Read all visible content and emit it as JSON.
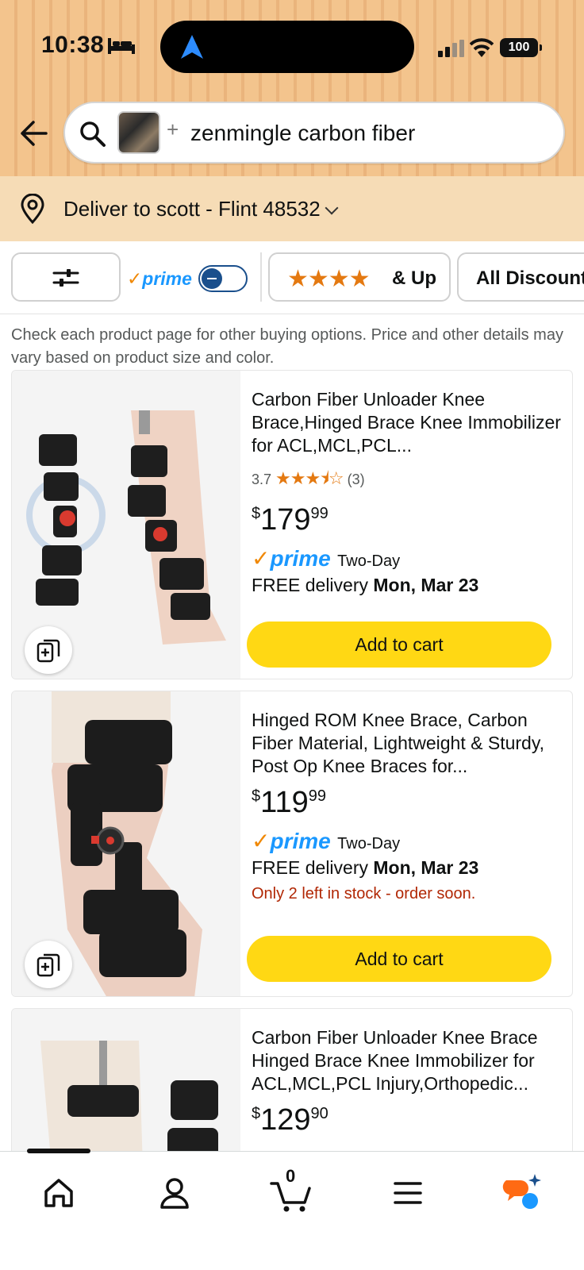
{
  "status_bar": {
    "time": "10:38",
    "battery": "100"
  },
  "search": {
    "query": "zenmingle carbon fiber",
    "plus": "+"
  },
  "delivery": {
    "label": "Deliver to scott - Flint 48532"
  },
  "filters": {
    "prime_label": "prime",
    "prime_check": "✓",
    "stars": "★★★★",
    "stars_suffix": "& Up",
    "all_discounts": "All Discounts"
  },
  "notice": "Check each product page for other buying options. Price and other details may vary based on product size and color.",
  "products": [
    {
      "title": "Carbon Fiber Unloader Knee Brace,Hinged Brace Knee Immobilizer for ACL,MCL,PCL...",
      "rating": "3.7",
      "rating_stars": "★★★⯨☆",
      "reviews": "(3)",
      "price_symbol": "$",
      "price_whole": "179",
      "price_fraction": "99",
      "prime": "prime",
      "prime_check": "✓",
      "shipping": "Two-Day",
      "delivery_prefix": "FREE delivery",
      "delivery_date": "Mon, Mar 23",
      "cart_label": "Add to cart"
    },
    {
      "title": "Hinged ROM Knee Brace, Carbon Fiber Material, Lightweight & Sturdy, Post Op Knee Braces for...",
      "price_symbol": "$",
      "price_whole": "119",
      "price_fraction": "99",
      "prime": "prime",
      "prime_check": "✓",
      "shipping": "Two-Day",
      "delivery_prefix": "FREE delivery",
      "delivery_date": "Mon, Mar 23",
      "stock": "Only 2 left in stock - order soon.",
      "cart_label": "Add to cart"
    },
    {
      "title": "Carbon Fiber Unloader Knee Brace Hinged Brace Knee Immobilizer for ACL,MCL,PCL Injury,Orthopedic...",
      "price_symbol": "$",
      "price_whole": "129",
      "price_fraction": "90"
    }
  ],
  "bottom_nav": {
    "cart_count": "0"
  },
  "icons": [
    "bed-icon",
    "navigation-arrow-icon",
    "signal-icon",
    "wifi-icon",
    "battery-icon",
    "back-arrow-icon",
    "search-icon",
    "location-pin-icon",
    "sliders-icon",
    "compare-icon",
    "home-icon",
    "account-icon",
    "cart-icon",
    "menu-icon",
    "rufus-ai-icon"
  ],
  "colors": {
    "header": "#f3c48d",
    "delivery_bar": "#f6dcb6",
    "cart_button": "#ffd814",
    "prime_blue": "#1a98ff",
    "prime_check": "#f08804",
    "stock_red": "#b12704",
    "star": "#e47911"
  }
}
